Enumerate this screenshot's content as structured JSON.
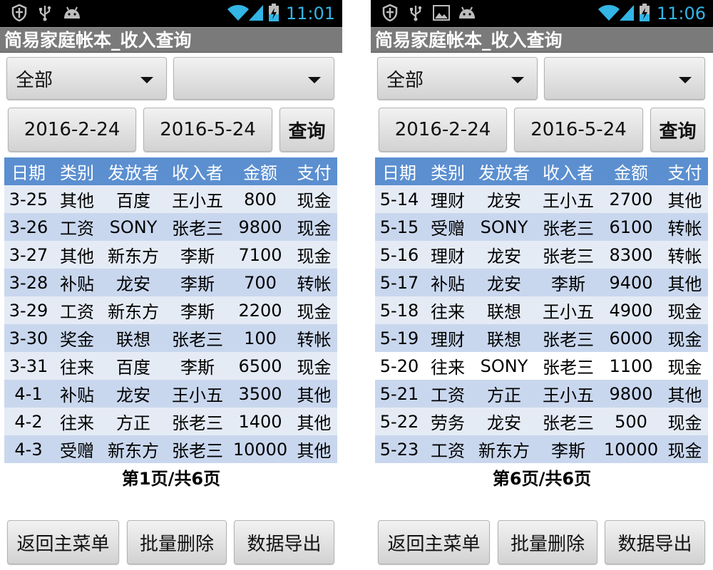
{
  "colors": {
    "statusbar": "#000000",
    "accent_time": "#33b5e5",
    "titlebar": "#7a7a7a",
    "table_header": "#5b8fd0",
    "row_even": "#c9d7ee",
    "row_odd": "#e5ebf5"
  },
  "screens": [
    {
      "statusbar": {
        "icons": [
          "shield-icon",
          "usb-icon",
          "android-icon"
        ],
        "time": "11:01"
      },
      "title": "简易家庭帐本_收入查询",
      "filters": {
        "category": "全部",
        "second": ""
      },
      "dates": {
        "start": "2016-2-24",
        "end": "2016-5-24",
        "query": "查询"
      },
      "table": {
        "headers": [
          "日期",
          "类别",
          "发放者",
          "收入者",
          "金额",
          "支付"
        ],
        "rows": [
          [
            "3-25",
            "其他",
            "百度",
            "王小五",
            "800",
            "现金"
          ],
          [
            "3-26",
            "工资",
            "SONY",
            "张老三",
            "9800",
            "现金"
          ],
          [
            "3-27",
            "其他",
            "新东方",
            "李斯",
            "7100",
            "现金"
          ],
          [
            "3-28",
            "补贴",
            "龙安",
            "李斯",
            "700",
            "转帐"
          ],
          [
            "3-29",
            "工资",
            "新东方",
            "李斯",
            "2200",
            "现金"
          ],
          [
            "3-30",
            "奖金",
            "联想",
            "张老三",
            "100",
            "转帐"
          ],
          [
            "3-31",
            "往来",
            "百度",
            "李斯",
            "6500",
            "现金"
          ],
          [
            "4-1",
            "补贴",
            "龙安",
            "王小五",
            "3500",
            "其他"
          ],
          [
            "4-2",
            "往来",
            "方正",
            "张老三",
            "1400",
            "其他"
          ],
          [
            "4-3",
            "受赠",
            "新东方",
            "张老三",
            "10000",
            "其他"
          ]
        ]
      },
      "page": "第1页/共6页",
      "buttons": {
        "back": "返回主菜单",
        "delete": "批量删除",
        "export": "数据导出"
      }
    },
    {
      "statusbar": {
        "icons": [
          "shield-icon",
          "usb-icon",
          "image-icon",
          "android-icon"
        ],
        "time": "11:06"
      },
      "title": "简易家庭帐本_收入查询",
      "filters": {
        "category": "全部",
        "second": ""
      },
      "dates": {
        "start": "2016-2-24",
        "end": "2016-5-24",
        "query": "查询"
      },
      "table": {
        "headers": [
          "日期",
          "类别",
          "发放者",
          "收入者",
          "金额",
          "支付"
        ],
        "rows": [
          [
            "5-14",
            "理财",
            "龙安",
            "王小五",
            "2700",
            "其他"
          ],
          [
            "5-15",
            "受赠",
            "SONY",
            "张老三",
            "6100",
            "转帐"
          ],
          [
            "5-16",
            "理财",
            "龙安",
            "张老三",
            "8300",
            "转帐"
          ],
          [
            "5-17",
            "补贴",
            "龙安",
            "李斯",
            "9400",
            "其他"
          ],
          [
            "5-18",
            "往来",
            "联想",
            "王小五",
            "4900",
            "现金"
          ],
          [
            "5-19",
            "理财",
            "联想",
            "张老三",
            "6000",
            "现金"
          ],
          [
            "5-20",
            "往来",
            "SONY",
            "张老三",
            "1100",
            "现金"
          ],
          [
            "5-21",
            "工资",
            "方正",
            "王小五",
            "9800",
            "其他"
          ],
          [
            "5-22",
            "劳务",
            "龙安",
            "张老三",
            "500",
            "现金"
          ],
          [
            "5-23",
            "工资",
            "新东方",
            "李斯",
            "10000",
            "现金"
          ]
        ]
      },
      "page": "第6页/共6页",
      "buttons": {
        "back": "返回主菜单",
        "delete": "批量删除",
        "export": "数据导出"
      }
    }
  ]
}
